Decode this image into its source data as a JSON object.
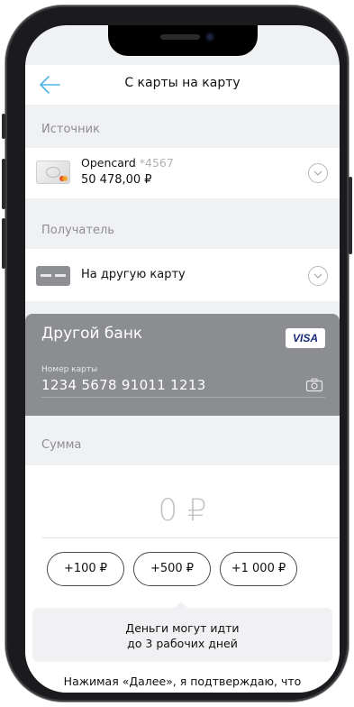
{
  "nav": {
    "title": "С карты на карту",
    "back_icon": "arrow-left-icon",
    "accent": "#4fb3e8"
  },
  "source": {
    "section_label": "Источник",
    "card_name": "Opencard",
    "card_mask": "*4567",
    "balance": "50 478,00 ₽"
  },
  "recipient": {
    "section_label": "Получатель",
    "option_label": "На другую карту"
  },
  "card": {
    "bank_name": "Другой банк",
    "brand": "VISA",
    "number_label": "Номер карты",
    "number_value": "1234 5678 91011 1213",
    "background": "#8b8d91"
  },
  "amount": {
    "section_label": "Сумма",
    "value": "0 ₽",
    "quick_amounts": [
      "+100 ₽",
      "+500 ₽",
      "+1 000 ₽"
    ]
  },
  "info": {
    "line1": "Деньги могут идти",
    "line2": "до 3 рабочих дней"
  },
  "footer": {
    "text": "Нажимая «Далее», я подтверждаю, что"
  }
}
